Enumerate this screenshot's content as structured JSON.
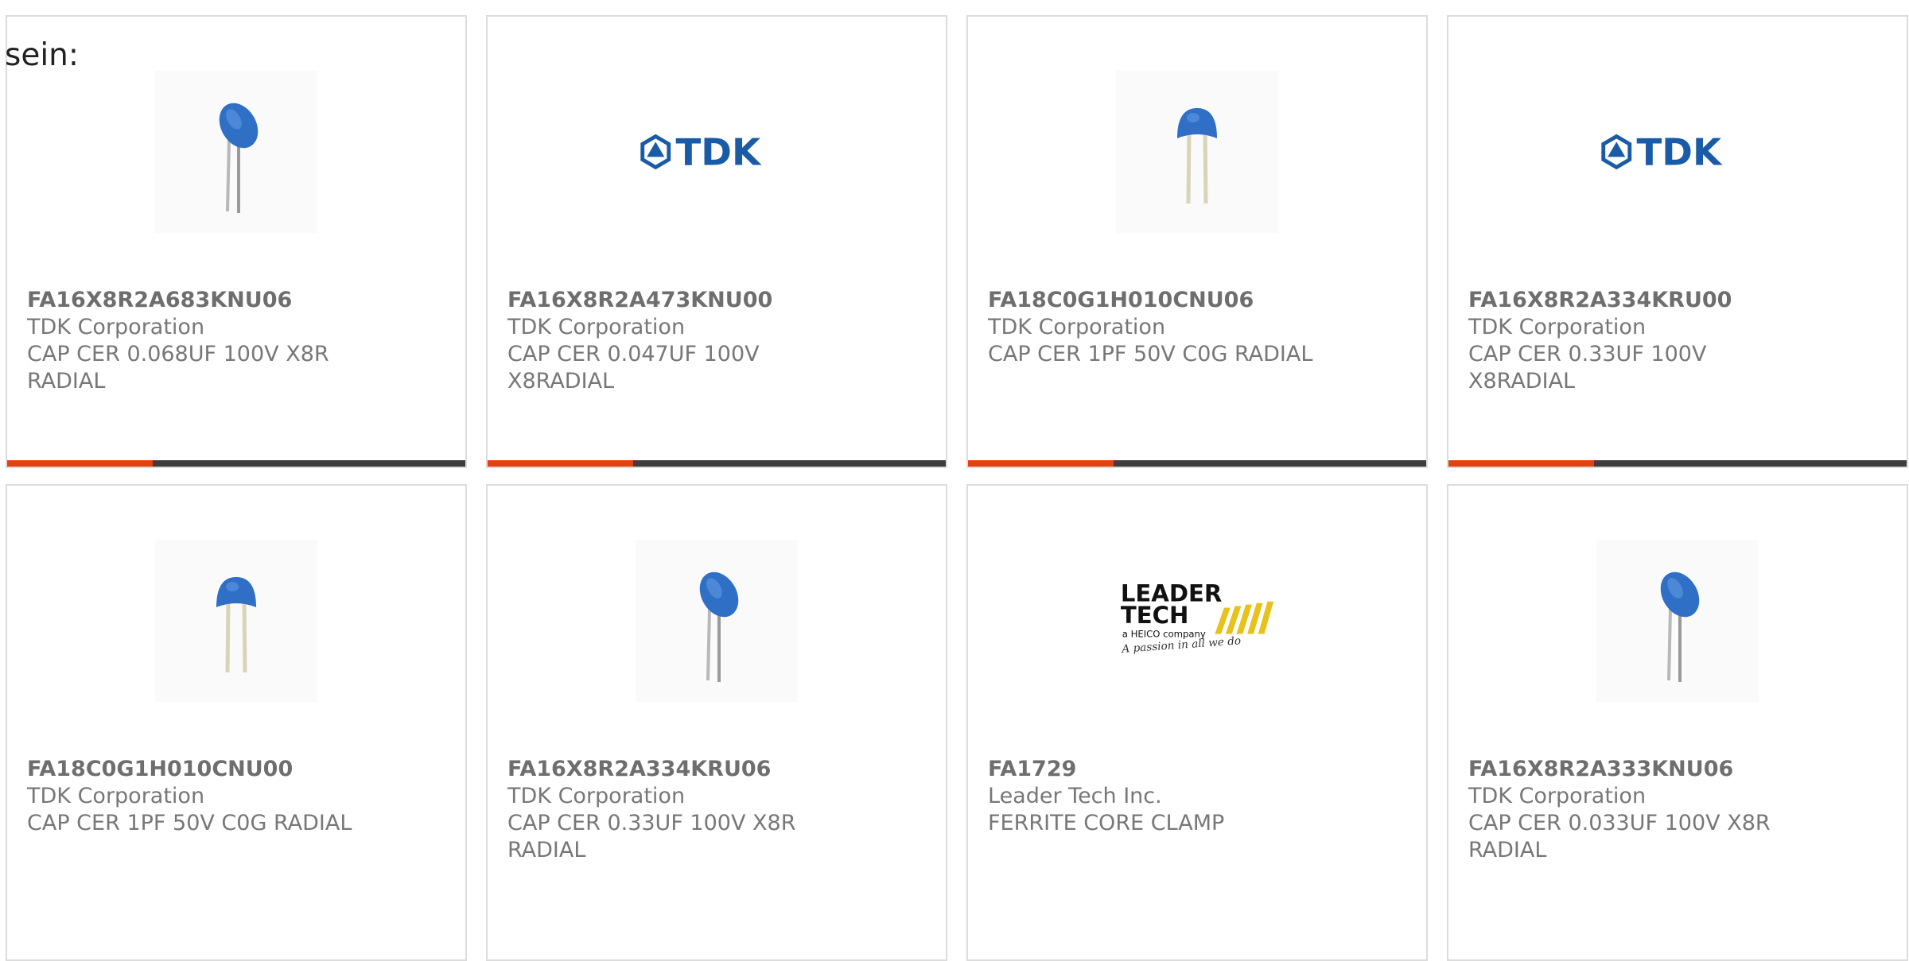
{
  "page": {
    "prefix_text": "sein:"
  },
  "colors": {
    "accent": "#e8400c",
    "bar": "#3d3d3d",
    "border": "#dcdcdc",
    "text": "#777777",
    "tdk_blue": "#1a5ba8",
    "capacitor_blue": "#2f6fc6"
  },
  "products": [
    {
      "part_number": "FA16X8R2A683KNU06",
      "manufacturer": "TDK Corporation",
      "description": "CAP CER 0.068UF 100V X8R RADIAL",
      "image": "radial-capacitor-tilted-photo",
      "accent_bar": true
    },
    {
      "part_number": "FA16X8R2A473KNU00",
      "manufacturer": "TDK Corporation",
      "description": "CAP CER 0.047UF 100V X8RADIAL",
      "image": "tdk-logo",
      "logo_text": "TDK",
      "accent_bar": true
    },
    {
      "part_number": "FA18C0G1H010CNU06",
      "manufacturer": "TDK Corporation",
      "description": "CAP CER 1PF 50V C0G RADIAL",
      "image": "radial-capacitor-upright-photo",
      "accent_bar": true
    },
    {
      "part_number": "FA16X8R2A334KRU00",
      "manufacturer": "TDK Corporation",
      "description": "CAP CER 0.33UF 100V X8RADIAL",
      "image": "tdk-logo",
      "logo_text": "TDK",
      "accent_bar": true
    },
    {
      "part_number": "FA18C0G1H010CNU00",
      "manufacturer": "TDK Corporation",
      "description": "CAP CER 1PF 50V C0G RADIAL",
      "image": "radial-capacitor-upright-photo",
      "accent_bar": false
    },
    {
      "part_number": "FA16X8R2A334KRU06",
      "manufacturer": "TDK Corporation",
      "description": "CAP CER 0.33UF 100V X8R RADIAL",
      "image": "radial-capacitor-tilted-photo",
      "accent_bar": false
    },
    {
      "part_number": "FA1729",
      "manufacturer": "Leader Tech Inc.",
      "description": "FERRITE CORE CLAMP",
      "image": "leader-tech-logo",
      "logo_line1": "LEADER",
      "logo_line2": "TECH",
      "logo_sub": "a HEICO company",
      "logo_tagline": "A passion in all we do",
      "accent_bar": false
    },
    {
      "part_number": "FA16X8R2A333KNU06",
      "manufacturer": "TDK Corporation",
      "description": "CAP CER 0.033UF 100V X8R RADIAL",
      "image": "radial-capacitor-tilted-photo",
      "accent_bar": false
    }
  ]
}
